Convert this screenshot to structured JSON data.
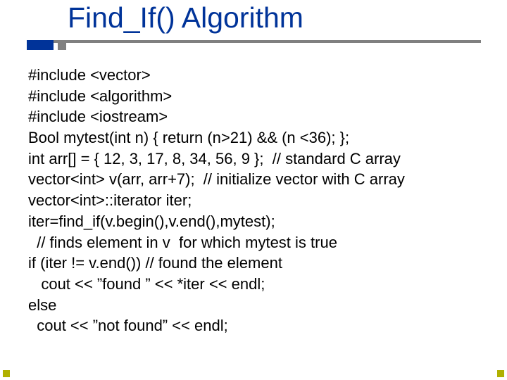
{
  "title": "Find_If() Algorithm",
  "lines": {
    "l0": "#include <vector>",
    "l1": "#include <algorithm>",
    "l2": "#include <iostream>",
    "l3": "Bool mytest(int n) { return (n>21) && (n <36); };",
    "l4": "int arr[] = { 12, 3, 17, 8, 34, 56, 9 };  // standard C array",
    "l5": "vector<int> v(arr, arr+7);  // initialize vector with C array",
    "l6": "vector<int>::iterator iter;",
    "l7": "iter=find_if(v.begin(),v.end(),mytest);",
    "l8": "  // finds element in v  for which mytest is true",
    "l9": "if (iter != v.end()) // found the element",
    "l10": "   cout << ”found ” << *iter << endl;",
    "l11": "else",
    "l12": "  cout << ”not found” << endl;"
  }
}
